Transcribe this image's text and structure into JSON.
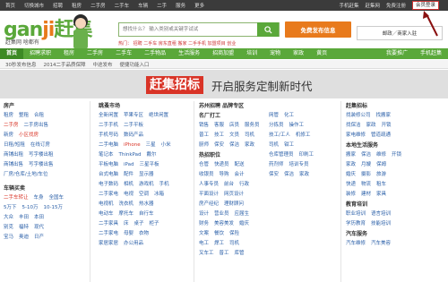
{
  "topbar": {
    "left": [
      "首页",
      "切换城市",
      "招聘",
      "租房",
      "二手房",
      "二手车",
      "车辆",
      "二手",
      "服务",
      "更多"
    ],
    "right_links": [
      "手机赶集",
      "赶集网",
      "免费注册"
    ],
    "login": "会员登录"
  },
  "header": {
    "slogan": "赶集网 啥都有",
    "search_placeholder": "想找什么？ 输入类别或关键字试试",
    "hot_prefix": "热门：",
    "hot": [
      "招聘",
      "二手车",
      "房东直租",
      "搬家",
      "二手手机",
      "加盟项目",
      "创业"
    ],
    "post_button": "免费发布信息",
    "store_button": "邮政／商家入驻"
  },
  "nav": {
    "items": [
      "首页",
      "招聘求职",
      "租房",
      "二手房",
      "二手车",
      "二手物品",
      "生活服务",
      "招商加盟",
      "培训",
      "宠物",
      "家政",
      "二手车",
      "黄页",
      "更多"
    ],
    "right": [
      "我要推广",
      "手机赶集"
    ]
  },
  "subnav": [
    "30秒发布信息",
    "2014二手品质保障",
    "中途发布",
    "便捷功能入口"
  ],
  "banner": {
    "part1": "赶集招标",
    "part2": "开启服务定制新时代"
  },
  "col1": {
    "title": "房产",
    "rows": [
      [
        "租房",
        "整租",
        "合租"
      ],
      [
        "二手房",
        "二手房出售"
      ],
      [
        "新房",
        "小区找房"
      ],
      [
        "日租/短租",
        "在线订房"
      ],
      [
        "商铺出租",
        "写字楼出租"
      ],
      [
        "商铺出售",
        "写字楼出售"
      ],
      [
        "厂房/仓库/土地/车位"
      ]
    ],
    "car_title": "车辆买卖",
    "car_rows": [
      [
        "二手车转让",
        "车身",
        "全国车"
      ],
      [
        "5万下",
        "5-10万",
        "10-15万"
      ],
      [
        "大众",
        "丰田",
        "本田"
      ],
      [
        "别克",
        "福特",
        "现代"
      ],
      [
        "宝马",
        "奥迪",
        "日产"
      ]
    ]
  },
  "col2": {
    "title": "跳蚤市场",
    "rows": [
      [
        "全新闲置",
        "苹果专区",
        "绝世闲置"
      ],
      [
        "二手手机",
        "二手平板"
      ],
      [
        "手机号码",
        "数码产品"
      ],
      [
        "二手电脑",
        "iPhone",
        "三星",
        "小米"
      ],
      [
        "笔记本",
        "ThinkPad",
        "戴尔"
      ],
      [
        "平板电脑",
        "iPad",
        "三星平板"
      ],
      [
        "台式电脑",
        "配件",
        "显示器"
      ],
      [
        "电子数码",
        "相机",
        "游戏机",
        "手机"
      ],
      [
        "二手家电",
        "电视",
        "空调",
        "冰箱"
      ],
      [
        "电视机",
        "洗衣机",
        "热水器"
      ],
      [
        "电动车",
        "摩托车",
        "自行车"
      ],
      [
        "二手家具",
        "床",
        "桌子",
        "柜子"
      ],
      [
        "二手家电",
        "母婴",
        "衣物"
      ],
      [
        "家居家居",
        "办公用品"
      ]
    ]
  },
  "col3": {
    "title": "苏州招聘",
    "subtitle": "名厂打工",
    "rows": [
      [
        "销售",
        "客服",
        "店员",
        "服务员"
      ],
      [
        "普工",
        "技工",
        "文员",
        "司机"
      ],
      [
        "厨师",
        "保安",
        "保洁",
        "家政"
      ],
      [
        "仓管",
        "快递员",
        "配送"
      ],
      [
        "收银员",
        "导购",
        "会计"
      ],
      [
        "人事专员",
        "前台",
        "行政"
      ],
      [
        "平面设计",
        "网页设计"
      ],
      [
        "房产经纪",
        "理财顾问"
      ]
    ],
    "hot_title": "热招职位"
  },
  "col4": {
    "title": "品牌专区",
    "rows": [
      [
        "设计",
        "营业员",
        "应届生"
      ],
      [
        "财务",
        "美容美发",
        "婚庆"
      ],
      [
        "文案",
        "餐饮",
        "保险"
      ],
      [
        "电工",
        "焊工",
        "司机"
      ],
      [
        "叉车工",
        "普工",
        "库管"
      ],
      [
        "网管",
        "化工",
        "物流"
      ],
      [
        "分拣员",
        "操作工"
      ],
      [
        "技工/工人",
        "机修工"
      ],
      [
        "司机",
        "钳工",
        "安装工"
      ],
      [
        "仓库管理员",
        "印刷工"
      ],
      [
        "药剂师",
        "培训专员"
      ],
      [
        "保安",
        "保洁",
        "家政"
      ]
    ]
  },
  "col5": {
    "title": "赶集招标",
    "rows": [
      [
        "找装修公司",
        "找搬家"
      ],
      [
        "找保洁",
        "家政",
        "开锁"
      ],
      [
        "家电维修",
        "管道疏通"
      ]
    ],
    "local_title": "本地生活服务",
    "local_rows": [
      [
        "搬家",
        "保洁",
        "维修",
        "开锁"
      ],
      [
        "家政",
        "月嫂",
        "保姆"
      ],
      [
        "婚庆",
        "摄影",
        "旅游"
      ],
      [
        "快递",
        "物流",
        "租车"
      ],
      [
        "装修",
        "建材",
        "家具"
      ]
    ],
    "edu_title": "教育培训",
    "edu_rows": [
      [
        "职业培训",
        "语言培训"
      ],
      [
        "学历教育",
        "技能培训"
      ]
    ],
    "car_title": "汽车服务",
    "car_rows": [
      [
        "汽车维修",
        "汽车美容"
      ]
    ]
  }
}
